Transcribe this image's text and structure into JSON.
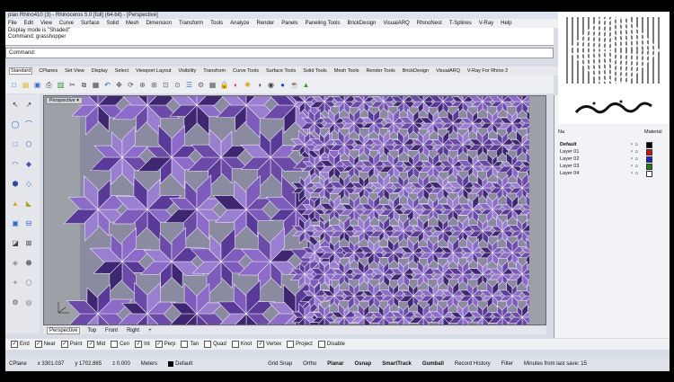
{
  "titlebar": {
    "title": "plan Rhino410 (3) - Rhinoceros 5.0 [full] (64-bit) - [Perspective]"
  },
  "menu": [
    "File",
    "Edit",
    "View",
    "Curve",
    "Surface",
    "Solid",
    "Mesh",
    "Dimension",
    "Transform",
    "Tools",
    "Analyze",
    "Render",
    "Panels",
    "Paneling Tools",
    "BrickDesign",
    "VisualARQ",
    "RhinoNest",
    "T-Splines",
    "V-Ray",
    "Help"
  ],
  "history": {
    "line1": "Display mode is \"Shaded\"",
    "line2": "Command: grasshopper"
  },
  "command": {
    "label": "Command:"
  },
  "toolbar_tabs": [
    {
      "label": "Standard"
    },
    {
      "label": "CPlanes"
    },
    {
      "label": "Set View"
    },
    {
      "label": "Display"
    },
    {
      "label": "Select"
    },
    {
      "label": "Viewport Layout"
    },
    {
      "label": "Visibility"
    },
    {
      "label": "Transform"
    },
    {
      "label": "Curve Tools"
    },
    {
      "label": "Surface Tools"
    },
    {
      "label": "Solid Tools"
    },
    {
      "label": "Mesh Tools"
    },
    {
      "label": "Render Tools"
    },
    {
      "label": "BrickDesign"
    },
    {
      "label": "VisualARQ"
    },
    {
      "label": "V-Ray For Rhino 2"
    }
  ],
  "viewport": {
    "title": "Perspective"
  },
  "viewport_tabs": [
    {
      "label": "Perspective"
    },
    {
      "label": "Top"
    },
    {
      "label": "Front"
    },
    {
      "label": "Right"
    },
    {
      "label": "+"
    }
  ],
  "osnaps": [
    {
      "label": "End",
      "checked": true
    },
    {
      "label": "Near",
      "checked": true
    },
    {
      "label": "Point",
      "checked": true
    },
    {
      "label": "Mid",
      "checked": true
    },
    {
      "label": "Cen",
      "checked": false
    },
    {
      "label": "Int",
      "checked": true
    },
    {
      "label": "Perp",
      "checked": true
    },
    {
      "label": "Tan",
      "checked": false
    },
    {
      "label": "Quad",
      "checked": false
    },
    {
      "label": "Knot",
      "checked": false
    },
    {
      "label": "Vertex",
      "checked": true
    },
    {
      "label": "Project",
      "checked": false
    },
    {
      "label": "Disable",
      "checked": false
    }
  ],
  "status": {
    "cplane": "CPlane",
    "x": "x 3301.037",
    "y": "y 1702.865",
    "z": "z 0.000",
    "units": "Meters",
    "layer": "Default",
    "grid_snap": "Grid Snap",
    "ortho": "Ortho",
    "planar": "Planar",
    "osnap": "Osnap",
    "smarttrack": "SmartTrack",
    "gumball": "Gumball",
    "record_history": "Record History",
    "filter": "Filter",
    "minutes": "Minutes from last save: 15"
  },
  "layers": {
    "header_name": "Na",
    "header_material": "Material",
    "rows": [
      {
        "name": "Default",
        "color": "#000000",
        "bold": true
      },
      {
        "name": "Layer 01",
        "color": "#d01010"
      },
      {
        "name": "Layer 02",
        "color": "#2020d0"
      },
      {
        "name": "Layer 03",
        "color": "#208020"
      },
      {
        "name": "Layer 04",
        "color": "#ffffff"
      }
    ]
  },
  "colors": {
    "mesh_purple": "#6b4aa8",
    "mesh_dark": "#3e2770",
    "mesh_light": "#9a7ed0",
    "viewport_bg": "#9da0a6"
  },
  "icons": [
    "new-file-icon",
    "open-icon",
    "save-icon",
    "print-icon",
    "import-icon",
    "cut-icon",
    "copy-icon",
    "paste-icon",
    "undo-icon",
    "pan-icon",
    "rotate-view-icon",
    "zoom-icon",
    "zoom-window-icon",
    "zoom-extents-icon",
    "zoom-selected-icon",
    "layers-icon",
    "properties-icon",
    "grid-icon",
    "lock-icon",
    "render-icon",
    "light-icon",
    "shading-icon",
    "material-icon",
    "sphere-icon",
    "teapot-icon",
    "grasshopper-icon"
  ]
}
